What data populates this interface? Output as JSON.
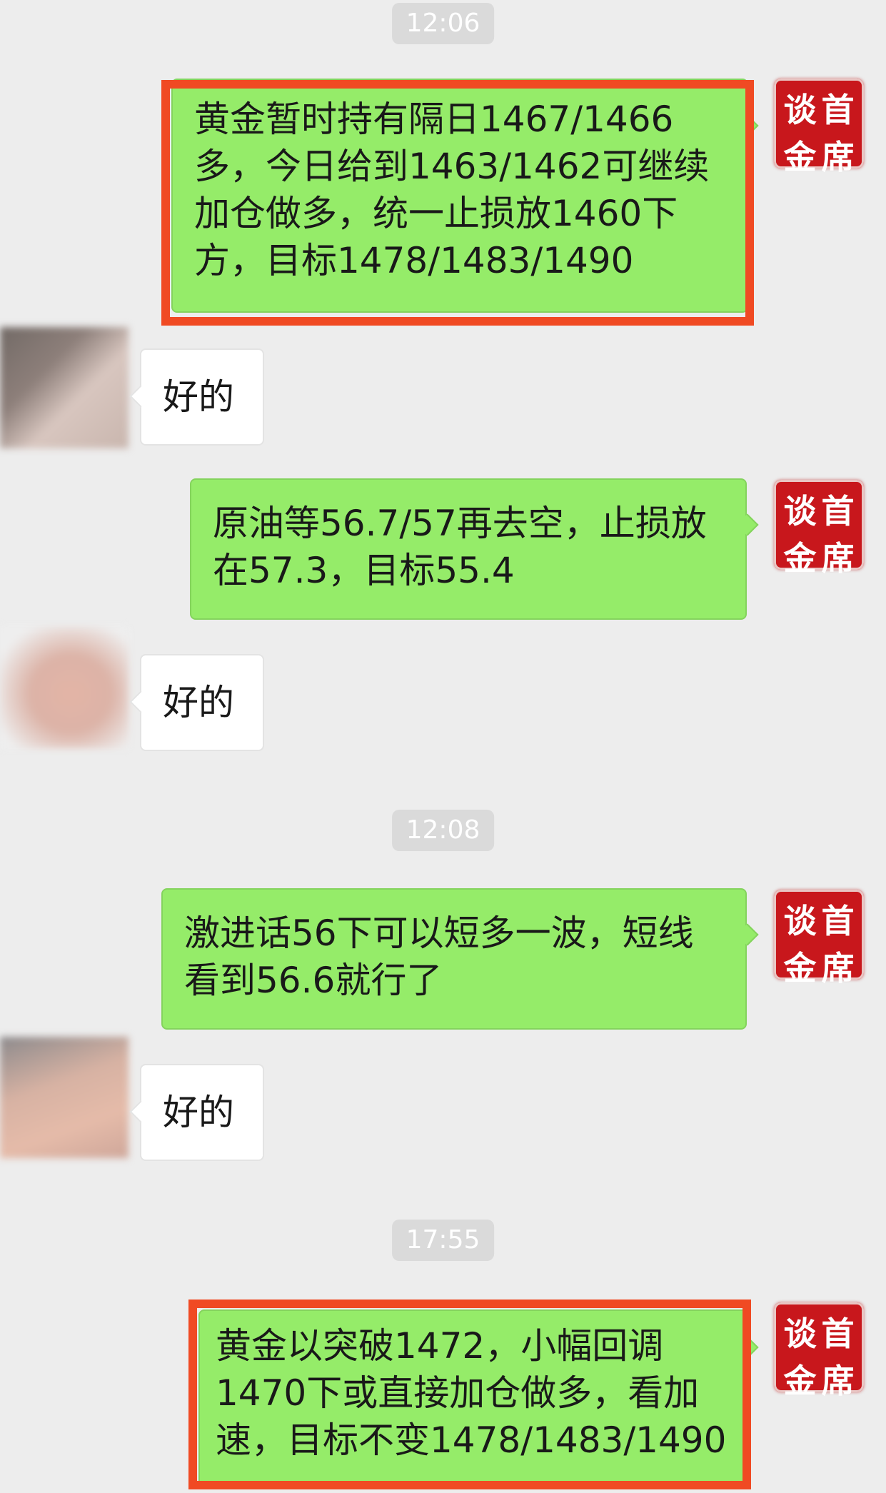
{
  "chat": {
    "timestamps": [
      "12:06",
      "12:08",
      "17:55"
    ],
    "sender_seal": {
      "chars": [
        "谈",
        "首",
        "金",
        "席"
      ]
    },
    "messages": [
      {
        "text": "黄金暂时持有隔日1467/1466多，今日给到1463/1462可继续加仓做多，统一止损放1460下方，目标1478/1483/1490",
        "highlighted": true
      },
      {
        "text": "好的"
      },
      {
        "text": "原油等56.7/57再去空，止损放在57.3，目标55.4",
        "highlighted": false
      },
      {
        "text": "好的"
      },
      {
        "text": "激进话56下可以短多一波，短线看到56.6就行了",
        "highlighted": false
      },
      {
        "text": "好的"
      },
      {
        "text": "黄金以突破1472，小幅回调1470下或直接加仓做多，看加速，目标不变1478/1483/1490",
        "highlighted": true
      }
    ]
  },
  "colors": {
    "background": "#ededed",
    "outgoing_bubble": "#95ec69",
    "incoming_bubble": "#ffffff",
    "highlight_border": "#f04a23",
    "seal": "#c8171c"
  }
}
